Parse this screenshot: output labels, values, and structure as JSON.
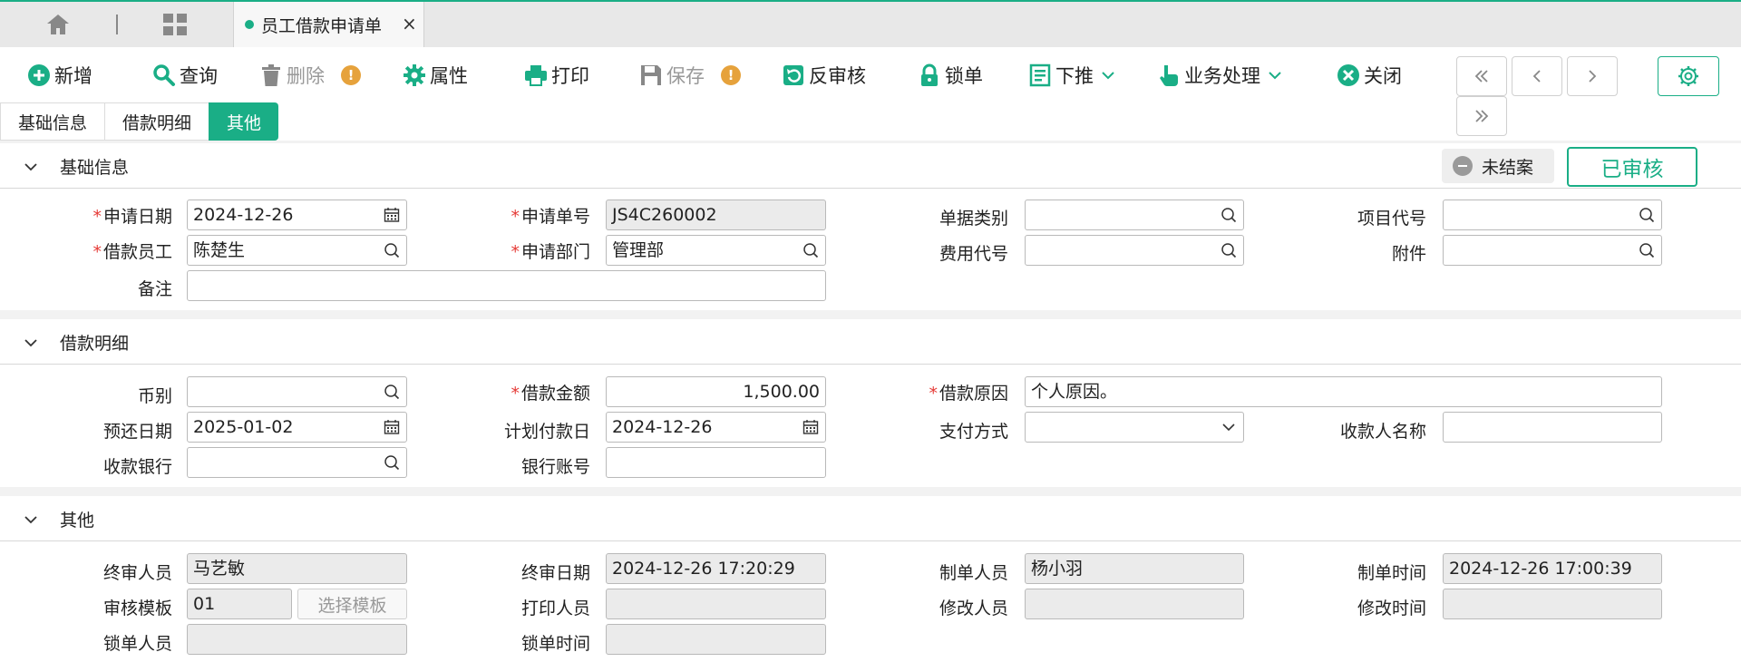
{
  "top_tab": {
    "title": "员工借款申请单",
    "close": "×"
  },
  "toolbar": {
    "add": "新增",
    "query": "查询",
    "delete": "删除",
    "properties": "属性",
    "print": "打印",
    "save": "保存",
    "unaudit": "反审核",
    "lock": "锁单",
    "push_down": "下推",
    "business": "业务处理",
    "close": "关闭",
    "warn_symbol": "!"
  },
  "section_tabs": [
    "基础信息",
    "借款明细",
    "其他"
  ],
  "status": {
    "unclosed": "未结案",
    "audited": "已审核"
  },
  "sections": {
    "basic": {
      "title": "基础信息",
      "apply_date": {
        "label": "申请日期",
        "value": "2024-12-26"
      },
      "apply_no": {
        "label": "申请单号",
        "value": "JS4C260002"
      },
      "doc_type": {
        "label": "单据类别",
        "value": ""
      },
      "project_code": {
        "label": "项目代号",
        "value": ""
      },
      "borrower": {
        "label": "借款员工",
        "value": "陈楚生"
      },
      "department": {
        "label": "申请部门",
        "value": "管理部"
      },
      "expense_code": {
        "label": "费用代号",
        "value": ""
      },
      "attachment": {
        "label": "附件",
        "value": ""
      },
      "remark": {
        "label": "备注",
        "value": ""
      }
    },
    "detail": {
      "title": "借款明细",
      "currency": {
        "label": "币别",
        "value": ""
      },
      "amount": {
        "label": "借款金额",
        "value": "1,500.00"
      },
      "reason": {
        "label": "借款原因",
        "value": "个人原因。"
      },
      "repay_date": {
        "label": "预还日期",
        "value": "2025-01-02"
      },
      "plan_pay_date": {
        "label": "计划付款日",
        "value": "2024-12-26"
      },
      "pay_method": {
        "label": "支付方式",
        "value": ""
      },
      "payee_name": {
        "label": "收款人名称",
        "value": ""
      },
      "payee_bank": {
        "label": "收款银行",
        "value": ""
      },
      "bank_account": {
        "label": "银行账号",
        "value": ""
      }
    },
    "other": {
      "title": "其他",
      "final_auditor": {
        "label": "终审人员",
        "value": "马艺敏"
      },
      "final_audit_date": {
        "label": "终审日期",
        "value": "2024-12-26 17:20:29"
      },
      "creator": {
        "label": "制单人员",
        "value": "杨小羽"
      },
      "create_time": {
        "label": "制单时间",
        "value": "2024-12-26 17:00:39"
      },
      "audit_template": {
        "label": "审核模板",
        "value": "01",
        "button": "选择模板"
      },
      "printer": {
        "label": "打印人员",
        "value": ""
      },
      "modifier": {
        "label": "修改人员",
        "value": ""
      },
      "modify_time": {
        "label": "修改时间",
        "value": ""
      },
      "locker": {
        "label": "锁单人员",
        "value": ""
      },
      "lock_time": {
        "label": "锁单时间",
        "value": ""
      }
    }
  },
  "colors": {
    "accent": "#1aae86",
    "required": "#e53935",
    "warning": "#e6a23c"
  },
  "icons": [
    "home-icon",
    "grid-icon",
    "plus-circle-icon",
    "search-icon",
    "trash-icon",
    "warning-icon",
    "gear-icon",
    "printer-icon",
    "floppy-icon",
    "undo-icon",
    "lock-icon",
    "document-icon",
    "hand-pointer-icon",
    "close-circle-icon",
    "double-chevron-left-icon",
    "chevron-left-icon",
    "chevron-right-icon",
    "double-chevron-right-icon",
    "chevron-down-icon",
    "calendar-icon"
  ]
}
